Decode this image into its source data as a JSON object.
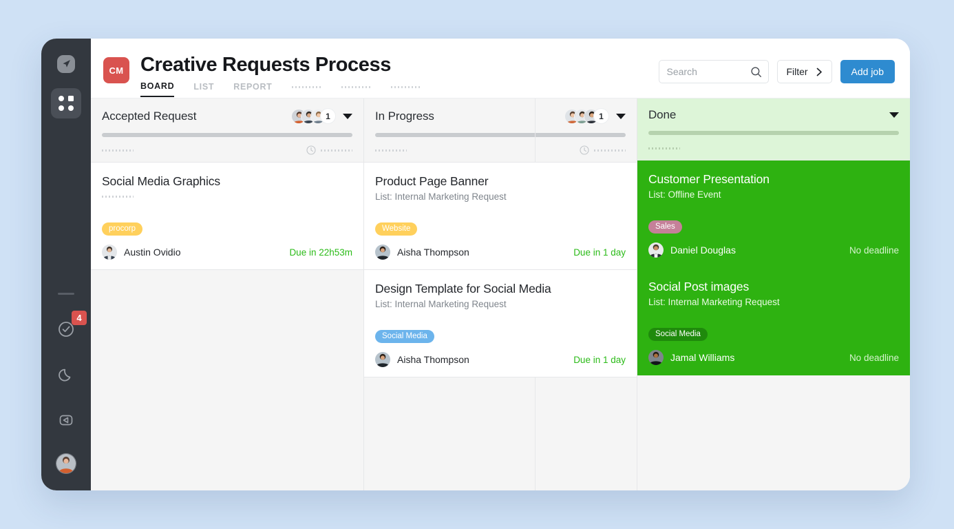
{
  "header": {
    "logo_badge": "CM",
    "title": "Creative Requests Process",
    "tabs": [
      {
        "label": "BOARD",
        "active": true
      },
      {
        "label": "LIST",
        "active": false
      },
      {
        "label": "REPORT",
        "active": false
      }
    ],
    "search": {
      "value": "",
      "placeholder": "Search"
    },
    "filter_label": "Filter",
    "add_job_label": "Add job"
  },
  "sidebar": {
    "notification_badge": "4",
    "icons": [
      "logo-arrow-icon",
      "apps-grid-icon",
      "check-circle-icon",
      "moon-icon",
      "collapse-panel-icon",
      "user-avatar"
    ]
  },
  "columns": [
    {
      "title": "Accepted Request",
      "count": "1",
      "avatars": 3,
      "theme": "default",
      "cards": [
        {
          "title": "Social Media Graphics",
          "subtitle": "",
          "has_sub_dots": true,
          "tag": {
            "label": "procorp",
            "color": "#ffd05c"
          },
          "assignee": "Austin Ovidio",
          "due": "Due in 22h53m"
        }
      ]
    },
    {
      "title": "In Progress",
      "count": "1",
      "avatars": 3,
      "theme": "default",
      "cards": [
        {
          "title": "Product Page Banner",
          "subtitle": "List: Internal Marketing Request",
          "has_sub_dots": false,
          "tag": {
            "label": "Website",
            "color": "#ffd05c"
          },
          "assignee": "Aisha Thompson",
          "due": "Due in 1 day"
        },
        {
          "title": "Design Template for Social Media",
          "subtitle": "List: Internal Marketing Request",
          "has_sub_dots": false,
          "tag": {
            "label": "Social Media",
            "color": "#6cb4ec"
          },
          "assignee": "Aisha Thompson",
          "due": "Due in 1 day"
        }
      ]
    },
    {
      "title": "Done",
      "count": "",
      "avatars": 0,
      "theme": "green",
      "cards": [
        {
          "title": "Customer Presentation",
          "subtitle": "List: Offline Event",
          "has_sub_dots": false,
          "tag": {
            "label": "Sales",
            "color": "#c58099"
          },
          "assignee": "Daniel Douglas",
          "due": "No deadline"
        },
        {
          "title": "Social Post images",
          "subtitle": "List: Internal Marketing Request",
          "has_sub_dots": false,
          "tag": {
            "label": "Social Media",
            "color": "#1f8a0c"
          },
          "assignee": "Jamal Williams",
          "due": "No deadline"
        }
      ]
    }
  ],
  "colors": {
    "page_background": "#cfe1f5",
    "sidebar": "#33383f",
    "brand_red": "#d9534f",
    "primary_blue": "#2e8bd0",
    "done_green": "#2eb211",
    "done_header_green": "#ddf5d8",
    "due_green": "#2bbb18"
  }
}
